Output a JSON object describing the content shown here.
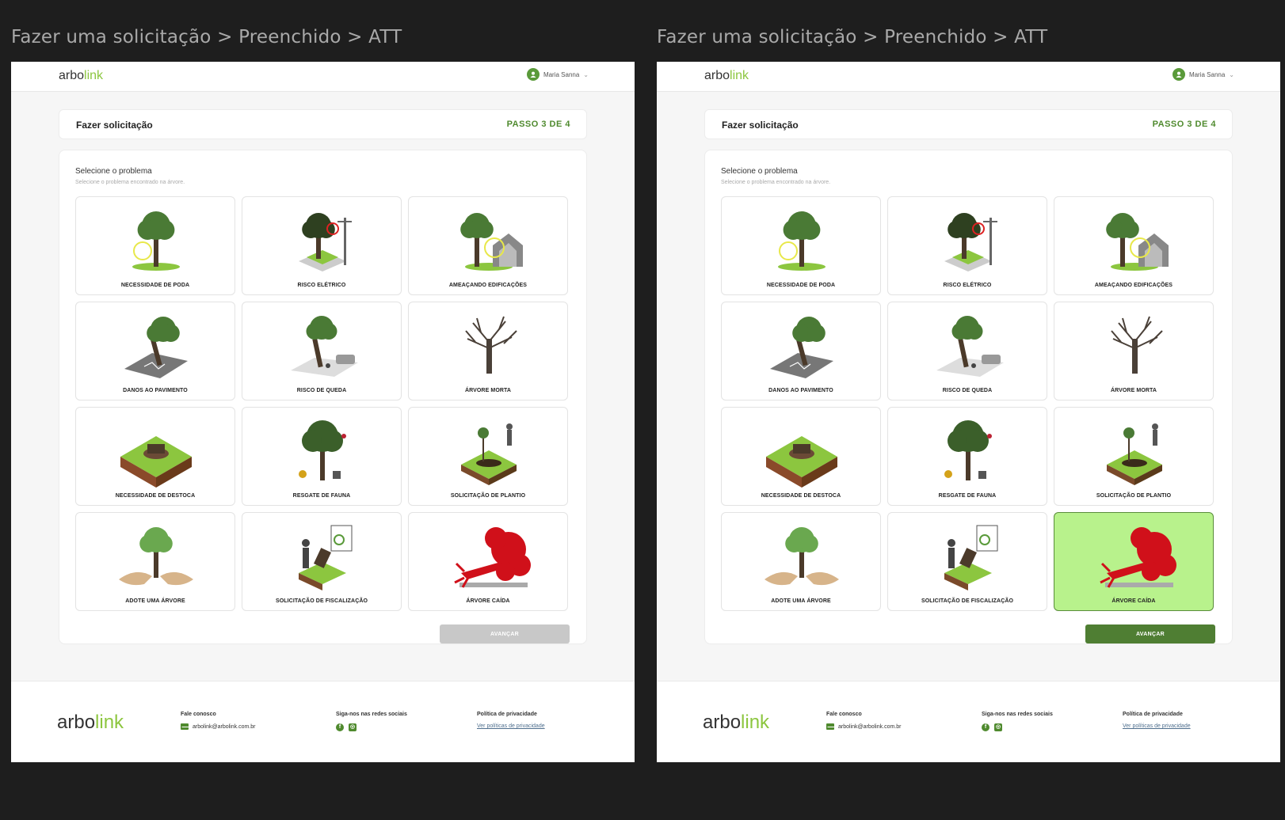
{
  "frames": [
    {
      "title": "Fazer uma solicitação > Preenchido > ATT",
      "selected_tile": null,
      "advance_enabled": false
    },
    {
      "title": "Fazer uma solicitação > Preenchido > ATT",
      "selected_tile": "ÁRVORE CAÍDA",
      "advance_enabled": true
    }
  ],
  "header": {
    "logo_prefix": "arbo",
    "logo_suffix": "link",
    "user_name": "Maria Sanna",
    "chevron": "⌄"
  },
  "step": {
    "title": "Fazer solicitação",
    "counter": "PASSO 3 DE 4"
  },
  "selection": {
    "title": "Selecione o problema",
    "subtitle": "Selecione o problema encontrado na árvore.",
    "options": [
      {
        "label": "NECESSIDADE DE PODA",
        "icon": "pruning-tree-icon"
      },
      {
        "label": "RISCO ELÉTRICO",
        "icon": "electric-risk-icon"
      },
      {
        "label": "AMEAÇANDO EDIFICAÇÕES",
        "icon": "threatening-building-icon"
      },
      {
        "label": "DANOS AO PAVIMENTO",
        "icon": "pavement-damage-icon"
      },
      {
        "label": "RISCO DE QUEDA",
        "icon": "fall-risk-icon"
      },
      {
        "label": "ÁRVORE MORTA",
        "icon": "dead-tree-icon"
      },
      {
        "label": "NECESSIDADE DE DESTOCA",
        "icon": "stump-removal-icon"
      },
      {
        "label": "RESGATE DE FAUNA",
        "icon": "fauna-rescue-icon"
      },
      {
        "label": "SOLICITAÇÃO DE PLANTIO",
        "icon": "planting-icon"
      },
      {
        "label": "ADOTE UMA ÁRVORE",
        "icon": "adopt-tree-icon"
      },
      {
        "label": "SOLICITAÇÃO DE FISCALIZAÇÃO",
        "icon": "inspection-icon"
      },
      {
        "label": "ÁRVORE CAÍDA",
        "icon": "fallen-tree-icon"
      }
    ],
    "advance_label": "AVANÇAR"
  },
  "footer": {
    "logo_prefix": "arbo",
    "logo_suffix": "link",
    "contact_heading": "Fale conosco",
    "contact_email": "arbolink@arbolink.com.br",
    "social_heading": "Siga-nos nas redes sociais",
    "privacy_heading": "Política de privacidade",
    "privacy_link": "Ver políticas de privacidade"
  },
  "colors": {
    "brand_green": "#4f8a2e",
    "logo_accent": "#8cc63f",
    "selected_bg": "#b8f28c",
    "button_disabled": "#c8c8c8",
    "button_enabled": "#4f7e33",
    "fallen_tree_red": "#d0101a"
  }
}
